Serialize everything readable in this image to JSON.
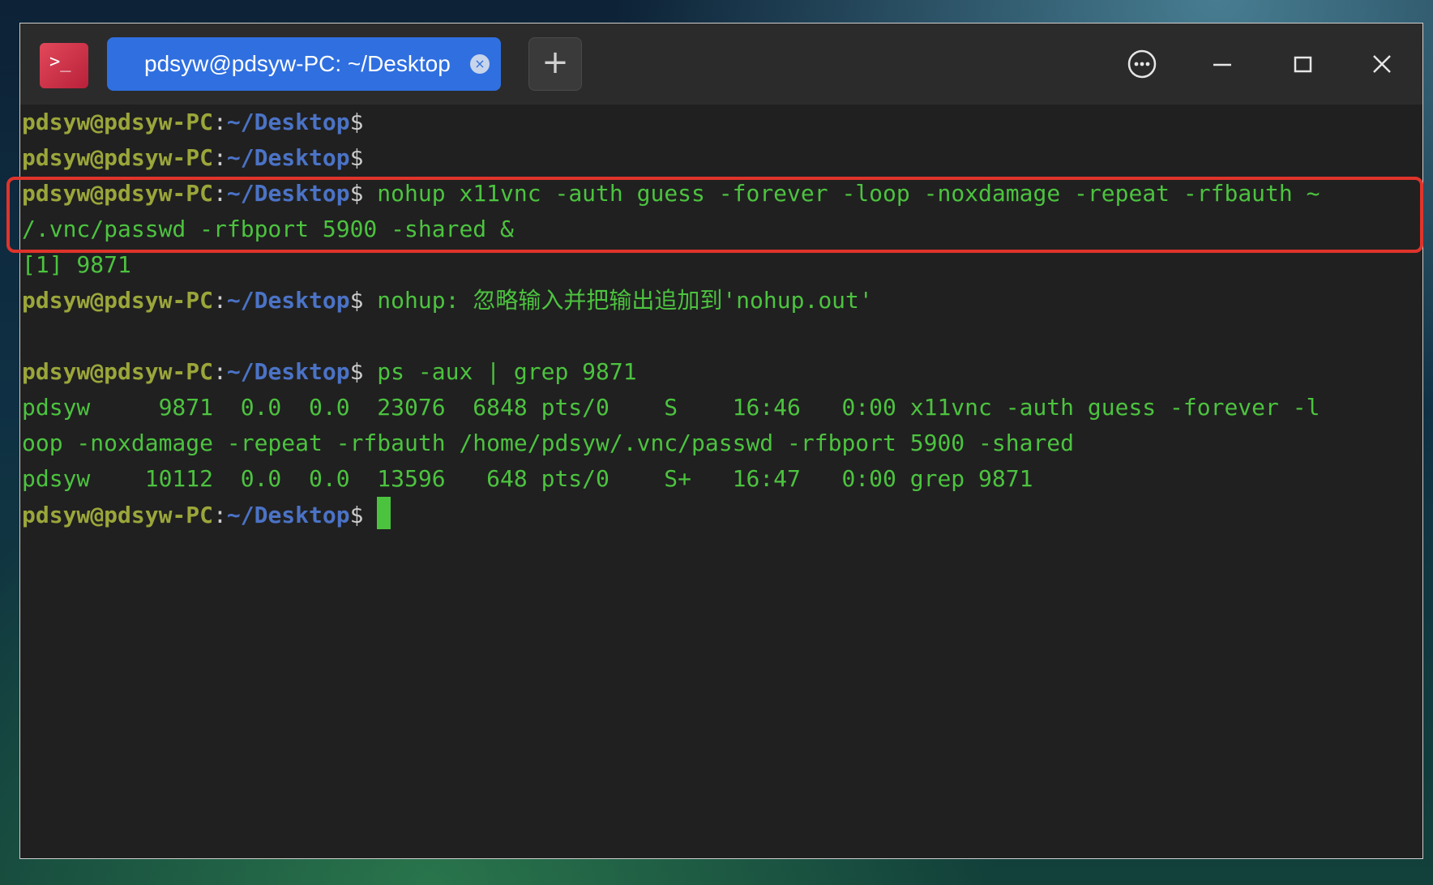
{
  "window": {
    "tab_title": "pdsyw@pdsyw-PC: ~/Desktop",
    "tab_close_glyph": "×",
    "new_tab_glyph": "+",
    "app_icon_glyph": ">_"
  },
  "prompt": {
    "user": "pdsyw@pdsyw-PC",
    "colon": ":",
    "path": "~/Desktop",
    "dollar": "$"
  },
  "lines": {
    "l3_cmd": " nohup x11vnc -auth guess -forever -loop -noxdamage -repeat -rfbauth ~",
    "l4": "/.vnc/passwd -rfbport 5900 -shared &",
    "l5": "[1] 9871",
    "l6_cmd": " nohup: 忽略输入并把输出追加到'nohup.out'",
    "l8_cmd": " ps -aux | grep 9871",
    "l9": "pdsyw     9871  0.0  0.0  23076  6848 pts/0    S    16:46   0:00 x11vnc -auth guess -forever -l",
    "l10": "oop -noxdamage -repeat -rfbauth /home/pdsyw/.vnc/passwd -rfbport 5900 -shared",
    "l11": "pdsyw    10112  0.0  0.0  13596   648 pts/0    S+   16:47   0:00 grep 9871",
    "l12_cmd": " "
  },
  "colors": {
    "prompt_user": "#9ba63a",
    "prompt_path": "#4b73c6",
    "output_green": "#4cc33f",
    "tab_active": "#2f6fe0",
    "highlight_box": "#e0342b"
  },
  "icons": {
    "app": "terminal-app-icon",
    "menu": "more-options-icon",
    "minimize": "minimize-icon",
    "maximize": "maximize-icon",
    "close": "close-icon"
  }
}
